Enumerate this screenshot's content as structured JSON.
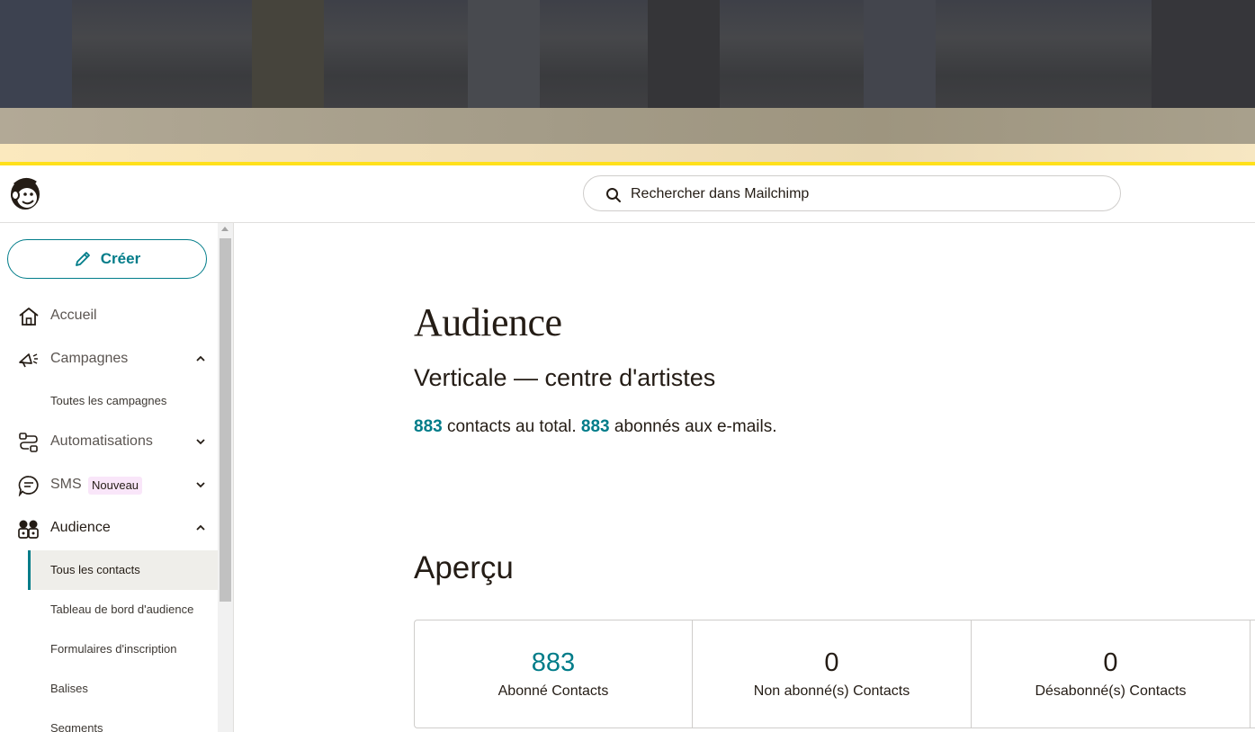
{
  "colors": {
    "accent": "#007c89",
    "brand_yellow": "#ffe01b",
    "text": "#241c15",
    "badge_bg": "#f9e6f9"
  },
  "header": {
    "search_placeholder": "Rechercher dans Mailchimp",
    "logo_icon": "mailchimp-freddie-icon"
  },
  "sidebar": {
    "create_label": "Créer",
    "items": [
      {
        "label": "Accueil",
        "icon": "home-icon"
      },
      {
        "label": "Campagnes",
        "icon": "megaphone-icon",
        "expanded": true,
        "children": [
          {
            "label": "Toutes les campagnes"
          }
        ]
      },
      {
        "label": "Automatisations",
        "icon": "automation-icon",
        "expanded": false
      },
      {
        "label": "SMS",
        "icon": "sms-icon",
        "badge": "Nouveau",
        "expanded": false
      },
      {
        "label": "Audience",
        "icon": "audience-icon",
        "expanded": true,
        "children": [
          {
            "label": "Tous les contacts",
            "active": true
          },
          {
            "label": "Tableau de bord d'audience"
          },
          {
            "label": "Formulaires d'inscription"
          },
          {
            "label": "Balises"
          },
          {
            "label": "Segments"
          }
        ]
      }
    ]
  },
  "main": {
    "title": "Audience",
    "audience_name": "Verticale — centre d'artistes",
    "summary": {
      "total": "883",
      "total_text": " contacts au total. ",
      "subscribed": "883",
      "subscribed_text": " abonnés aux e-mails."
    },
    "overview_title": "Aperçu",
    "stats": [
      {
        "value": "883",
        "label": "Abonné Contacts"
      },
      {
        "value": "0",
        "label": "Non abonné(s) Contacts"
      },
      {
        "value": "0",
        "label": "Désabonné(s) Contacts"
      }
    ]
  }
}
